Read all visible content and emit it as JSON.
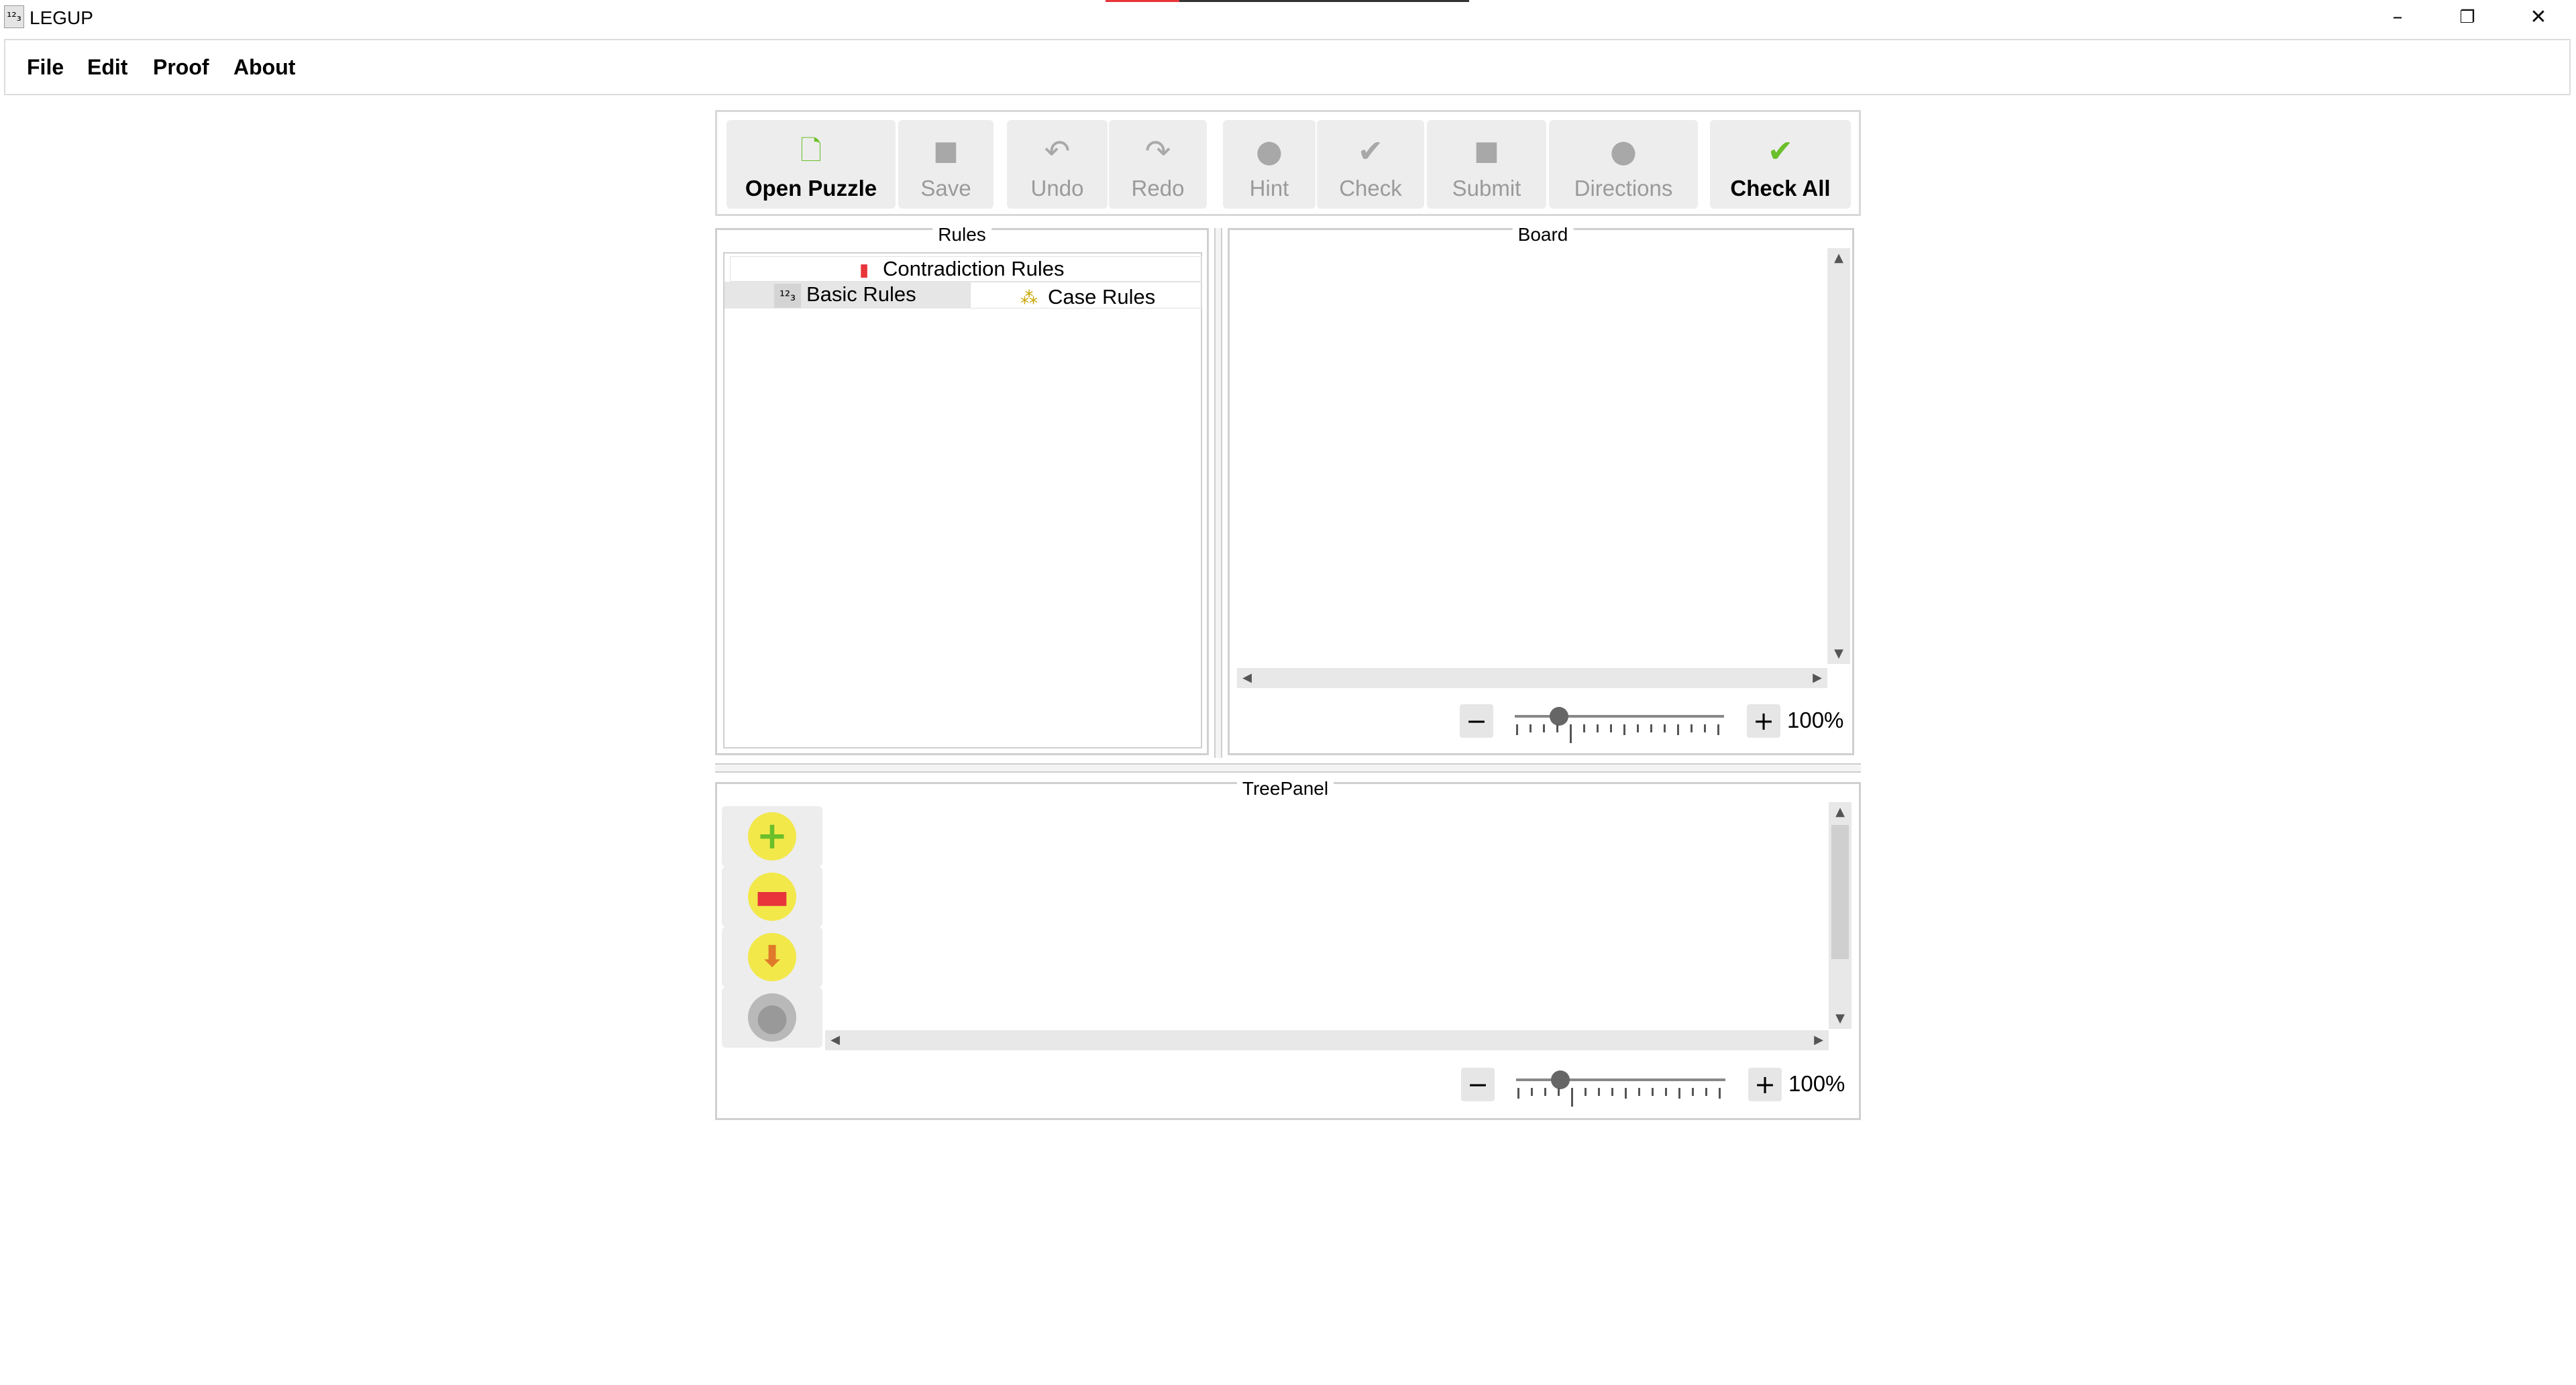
{
  "window": {
    "title": "LEGUP",
    "icon": "legup-123-icon",
    "controls": [
      "minimize-icon",
      "restore-icon",
      "close-icon"
    ]
  },
  "menu": {
    "items": [
      "File",
      "Edit",
      "Proof",
      "About"
    ]
  },
  "toolbar": {
    "buttons": [
      {
        "label": "Open Puzzle",
        "icon": "open-puzzle-icon",
        "enabled": true
      },
      {
        "label": "Save",
        "icon": "save-icon",
        "enabled": false
      },
      {
        "label": "Undo",
        "icon": "undo-icon",
        "enabled": false
      },
      {
        "label": "Redo",
        "icon": "redo-icon",
        "enabled": false
      },
      {
        "label": "Hint",
        "icon": "hint-icon",
        "enabled": false
      },
      {
        "label": "Check",
        "icon": "check-icon",
        "enabled": false
      },
      {
        "label": "Submit",
        "icon": "submit-icon",
        "enabled": false
      },
      {
        "label": "Directions",
        "icon": "directions-icon",
        "enabled": false
      },
      {
        "label": "Check All",
        "icon": "check-all-icon",
        "enabled": true
      }
    ]
  },
  "rules": {
    "title": "Rules",
    "tabs": {
      "contradiction": "Contradiction Rules",
      "basic": "Basic Rules",
      "case": "Case Rules"
    },
    "selected_tab": "Basic Rules"
  },
  "board": {
    "title": "Board",
    "zoom": "100%",
    "zoom_minus": "−",
    "zoom_plus": "+"
  },
  "tree": {
    "title": "TreePanel",
    "zoom": "100%",
    "zoom_minus": "−",
    "zoom_plus": "+",
    "tools": [
      "add-node-icon",
      "delete-node-icon",
      "merge-node-icon",
      "collapse-node-icon"
    ]
  },
  "colors": {
    "accent_red": "#e8343a",
    "panel_border": "#d0d0d0",
    "button_bg": "#ededed",
    "disabled_text": "#9a9a9a",
    "check_green": "#6bbf2a"
  }
}
